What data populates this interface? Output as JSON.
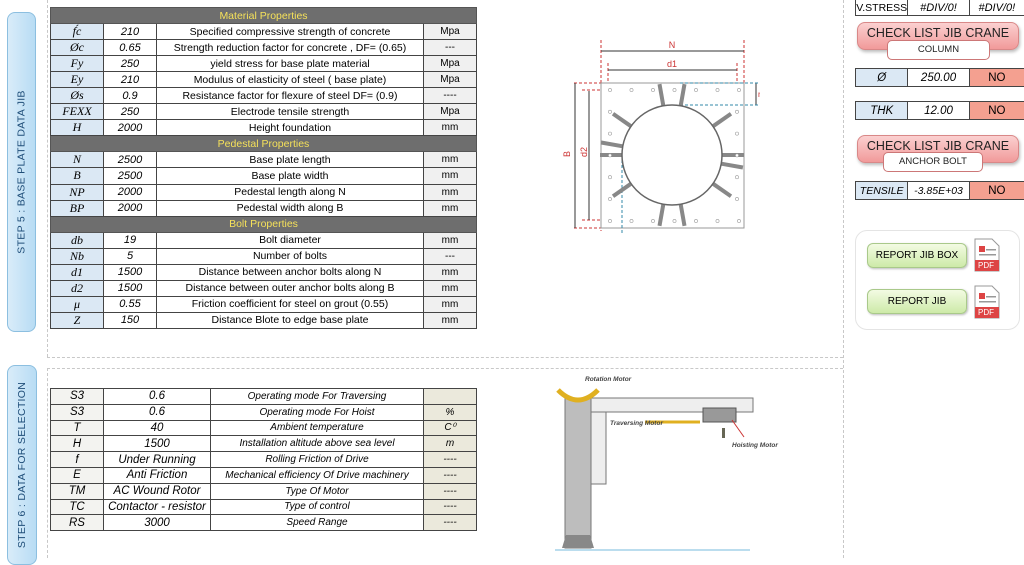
{
  "step5": {
    "label": "STEP 5 : BASE PLATE DATA JIB"
  },
  "step6": {
    "label": "STEP 6 : DATA FOR SELECTION"
  },
  "base_plate": {
    "sections": [
      {
        "title": "Material Properties",
        "rows": [
          {
            "symbol": "f́c",
            "value": "210",
            "desc": "Specified compressive strength of concrete",
            "unit": "Mpa"
          },
          {
            "symbol": "Øc",
            "value": "0.65",
            "desc": "Strength reduction factor for concrete , DF= (0.65)",
            "unit": "---"
          },
          {
            "symbol": "Fy",
            "value": "250",
            "desc": "yield stress  for base plate material",
            "unit": "Mpa"
          },
          {
            "symbol": "Ey",
            "value": "210",
            "desc": "Modulus of elasticity of steel ( base plate)",
            "unit": "Mpa"
          },
          {
            "symbol": "Øs",
            "value": "0.9",
            "desc": "Resistance factor for flexure of steel DF= (0.9)",
            "unit": "----"
          },
          {
            "symbol": "FEXX",
            "value": "250",
            "desc": "Electrode tensile strength",
            "unit": "Mpa"
          },
          {
            "symbol": "H",
            "value": "2000",
            "desc": "Height foundation",
            "unit": "mm"
          }
        ]
      },
      {
        "title": "Pedestal Properties",
        "rows": [
          {
            "symbol": "N",
            "value": "2500",
            "desc": "Base plate length",
            "unit": "mm"
          },
          {
            "symbol": "B",
            "value": "2500",
            "desc": "Base plate width",
            "unit": "mm"
          },
          {
            "symbol": "NP",
            "value": "2000",
            "desc": "Pedestal length along N",
            "unit": "mm"
          },
          {
            "symbol": "BP",
            "value": "2000",
            "desc": "Pedestal width along B",
            "unit": "mm"
          }
        ]
      },
      {
        "title": "Bolt Properties",
        "rows": [
          {
            "symbol": "db",
            "value": "19",
            "desc": "Bolt diameter",
            "unit": "mm"
          },
          {
            "symbol": "Nb",
            "value": "5",
            "desc": "Number of bolts",
            "unit": "---"
          },
          {
            "symbol": "d1",
            "value": "1500",
            "desc": "Distance between anchor bolts along N",
            "unit": "mm"
          },
          {
            "symbol": "d2",
            "value": "1500",
            "desc": "Distance between outer anchor bolts along  B",
            "unit": "mm"
          },
          {
            "symbol": "μ",
            "value": "0.55",
            "desc": "Friction coefficient for steel on grout (0.55)",
            "unit": "mm"
          },
          {
            "symbol": "Z",
            "value": "150",
            "desc": "Distance Blote to edge base plate",
            "unit": "mm"
          }
        ]
      }
    ]
  },
  "plate_diagram": {
    "labels": {
      "N": "N",
      "d1": "d1",
      "B": "B",
      "d2": "d2",
      "n": "n",
      "m": "m"
    }
  },
  "selection": {
    "rows": [
      {
        "symbol": "S3",
        "value": "0.6",
        "desc": "Operating mode For Traversing",
        "unit": ""
      },
      {
        "symbol": "S3",
        "value": "0.6",
        "desc": "Operating mode For Hoist",
        "unit": "%"
      },
      {
        "symbol": "T",
        "value": "40",
        "desc": "Ambient temperature",
        "unit": "C⁰"
      },
      {
        "symbol": "H",
        "value": "1500",
        "desc": "Installation altitude above sea level",
        "unit": "m"
      },
      {
        "symbol": "f",
        "value": "Under Running",
        "desc": "Rolling Friction of Drive",
        "unit": "----"
      },
      {
        "symbol": "E",
        "value": "Anti Friction",
        "desc": "Mechanical efficiency Of Drive machinery",
        "unit": "----"
      },
      {
        "symbol": "TM",
        "value": "AC Wound Rotor",
        "desc": "Type Of Motor",
        "unit": "----"
      },
      {
        "symbol": "TC",
        "value": "Contactor - resistor",
        "desc": "Type of control",
        "unit": "----"
      },
      {
        "symbol": "RS",
        "value": "3000",
        "desc": "Speed Range",
        "unit": "----"
      }
    ]
  },
  "crane_diagram": {
    "rotation": "Rotation Motor",
    "traversing": "Traversing Motor",
    "hoisting": "Hoisting Motor"
  },
  "right": {
    "top_row": [
      "V.STRESS",
      "#DIV/0!",
      "#DIV/0!"
    ],
    "check1": {
      "title": "CHECK LIST JIB CRANE",
      "sub": "COLUMN"
    },
    "dia": [
      "Ø",
      "250.00",
      "NO"
    ],
    "thk": [
      "THK",
      "12.00",
      "NO"
    ],
    "check2": {
      "title": "CHECK LIST JIB CRANE",
      "sub": "ANCHOR BOLT"
    },
    "tensile": [
      "TENSILE",
      "-3.85E+03",
      "NO"
    ],
    "report_box": "REPORT JIB BOX",
    "report_jib": "REPORT JIB",
    "pdf": "PDF"
  },
  "colors": {
    "header_bg": "#6e6e6e",
    "header_text": "#f5e15a",
    "no_status": "#f4a090",
    "symbol_bg": "#dbe8f4"
  }
}
